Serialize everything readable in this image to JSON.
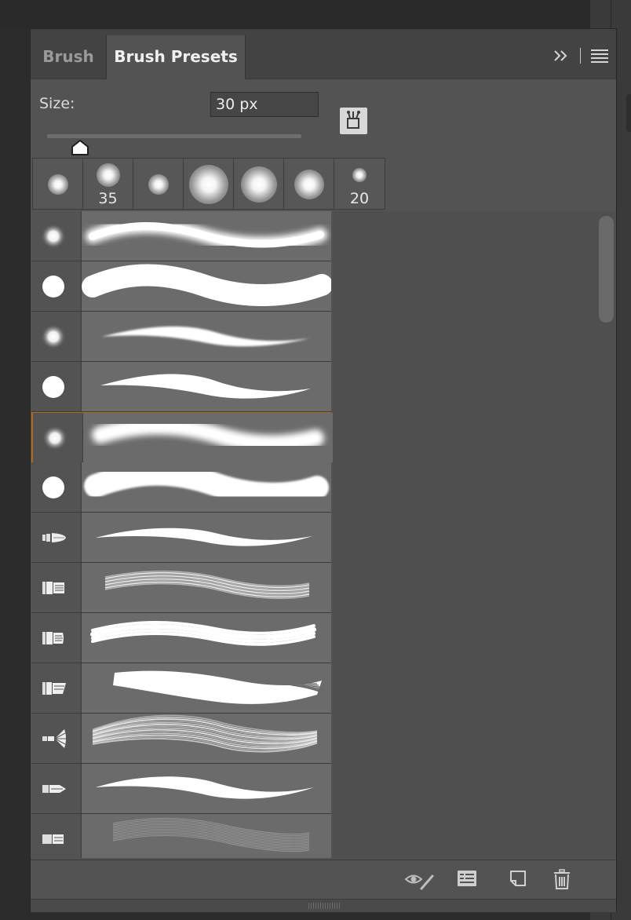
{
  "tabs": [
    {
      "label": "Brush",
      "active": false
    },
    {
      "label": "Brush Presets",
      "active": true
    }
  ],
  "header_icons": {
    "collapse": "double-chevron-right-icon",
    "menu": "hamburger-menu-icon"
  },
  "size": {
    "label": "Size:",
    "value": "30 px",
    "slider_fraction": 0.13
  },
  "brush_manager_icon": "brush-preset-manager-icon",
  "recent_brushes": [
    {
      "type": "soft",
      "label": ""
    },
    {
      "type": "soft",
      "label": "35"
    },
    {
      "type": "soft",
      "label": ""
    },
    {
      "type": "soft",
      "label": ""
    },
    {
      "type": "soft",
      "label": ""
    },
    {
      "type": "soft",
      "label": ""
    },
    {
      "type": "soft",
      "label": "20"
    }
  ],
  "presets": [
    {
      "tip": "soft-round",
      "stroke": "soft"
    },
    {
      "tip": "hard-round",
      "stroke": "hard"
    },
    {
      "tip": "soft-round",
      "stroke": "soft-taper"
    },
    {
      "tip": "hard-round",
      "stroke": "hard-taper"
    },
    {
      "tip": "soft-round",
      "stroke": "soft-wide",
      "selected": true
    },
    {
      "tip": "hard-round",
      "stroke": "hard-soft-edge"
    },
    {
      "tip": "round-bristle",
      "stroke": "thin-taper"
    },
    {
      "tip": "flat-bristle",
      "stroke": "bristle-streaks"
    },
    {
      "tip": "flat-bristle-small",
      "stroke": "bristle-multi"
    },
    {
      "tip": "angled-bristle",
      "stroke": "dry-brush"
    },
    {
      "tip": "fan-bristle",
      "stroke": "fan-streaks"
    },
    {
      "tip": "point-bristle",
      "stroke": "point-taper"
    },
    {
      "tip": "flat-blunt",
      "stroke": "faint-streaks"
    }
  ],
  "bottom_icons": [
    "toggle-live-tip-preview-icon",
    "brush-panel-icon",
    "new-preset-icon",
    "delete-icon"
  ],
  "colors": {
    "panel": "#535353",
    "tabbar": "#434343",
    "selection": "#b06a12",
    "stroke_bg": "#6b6b6b"
  }
}
